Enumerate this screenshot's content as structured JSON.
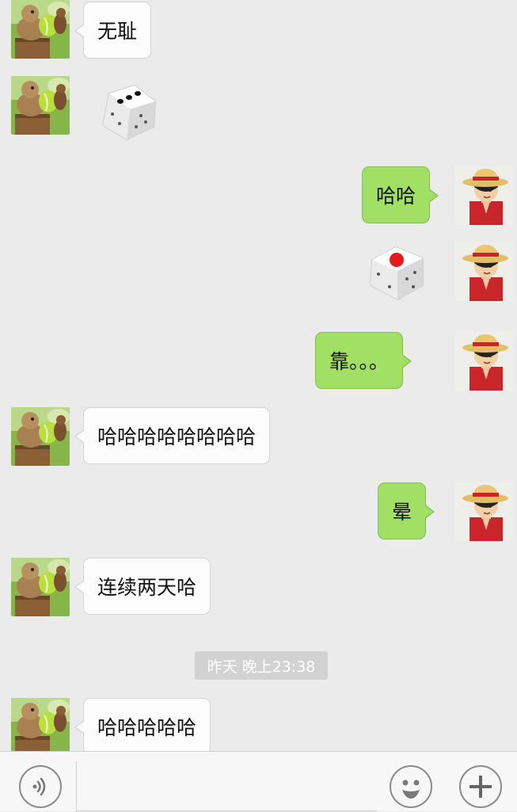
{
  "messages": [
    {
      "side": "left",
      "type": "text",
      "text": "无耻"
    },
    {
      "side": "left",
      "type": "dice",
      "pips": 3
    },
    {
      "side": "right",
      "type": "text",
      "text": "哈哈"
    },
    {
      "side": "right",
      "type": "dice",
      "pips": 1
    },
    {
      "side": "right",
      "type": "text",
      "text": "靠。。。"
    },
    {
      "side": "left",
      "type": "text",
      "text": "哈哈哈哈哈哈哈哈"
    },
    {
      "side": "right",
      "type": "text",
      "text": "晕"
    },
    {
      "side": "left",
      "type": "text",
      "text": "连续两天哈"
    },
    {
      "side": "left",
      "type": "text",
      "text": "哈哈哈哈哈"
    }
  ],
  "timestamp": "昨天 晚上23:38",
  "input_bar": {
    "voice_icon": "voice-icon",
    "emoji_icon": "emoji-icon",
    "plus_icon": "plus-icon"
  },
  "colors": {
    "background": "#ebebeb",
    "sent_bubble": "#a2e065",
    "received_bubble": "#fcfcfc",
    "timestamp_bg": "#d2d2d2"
  }
}
